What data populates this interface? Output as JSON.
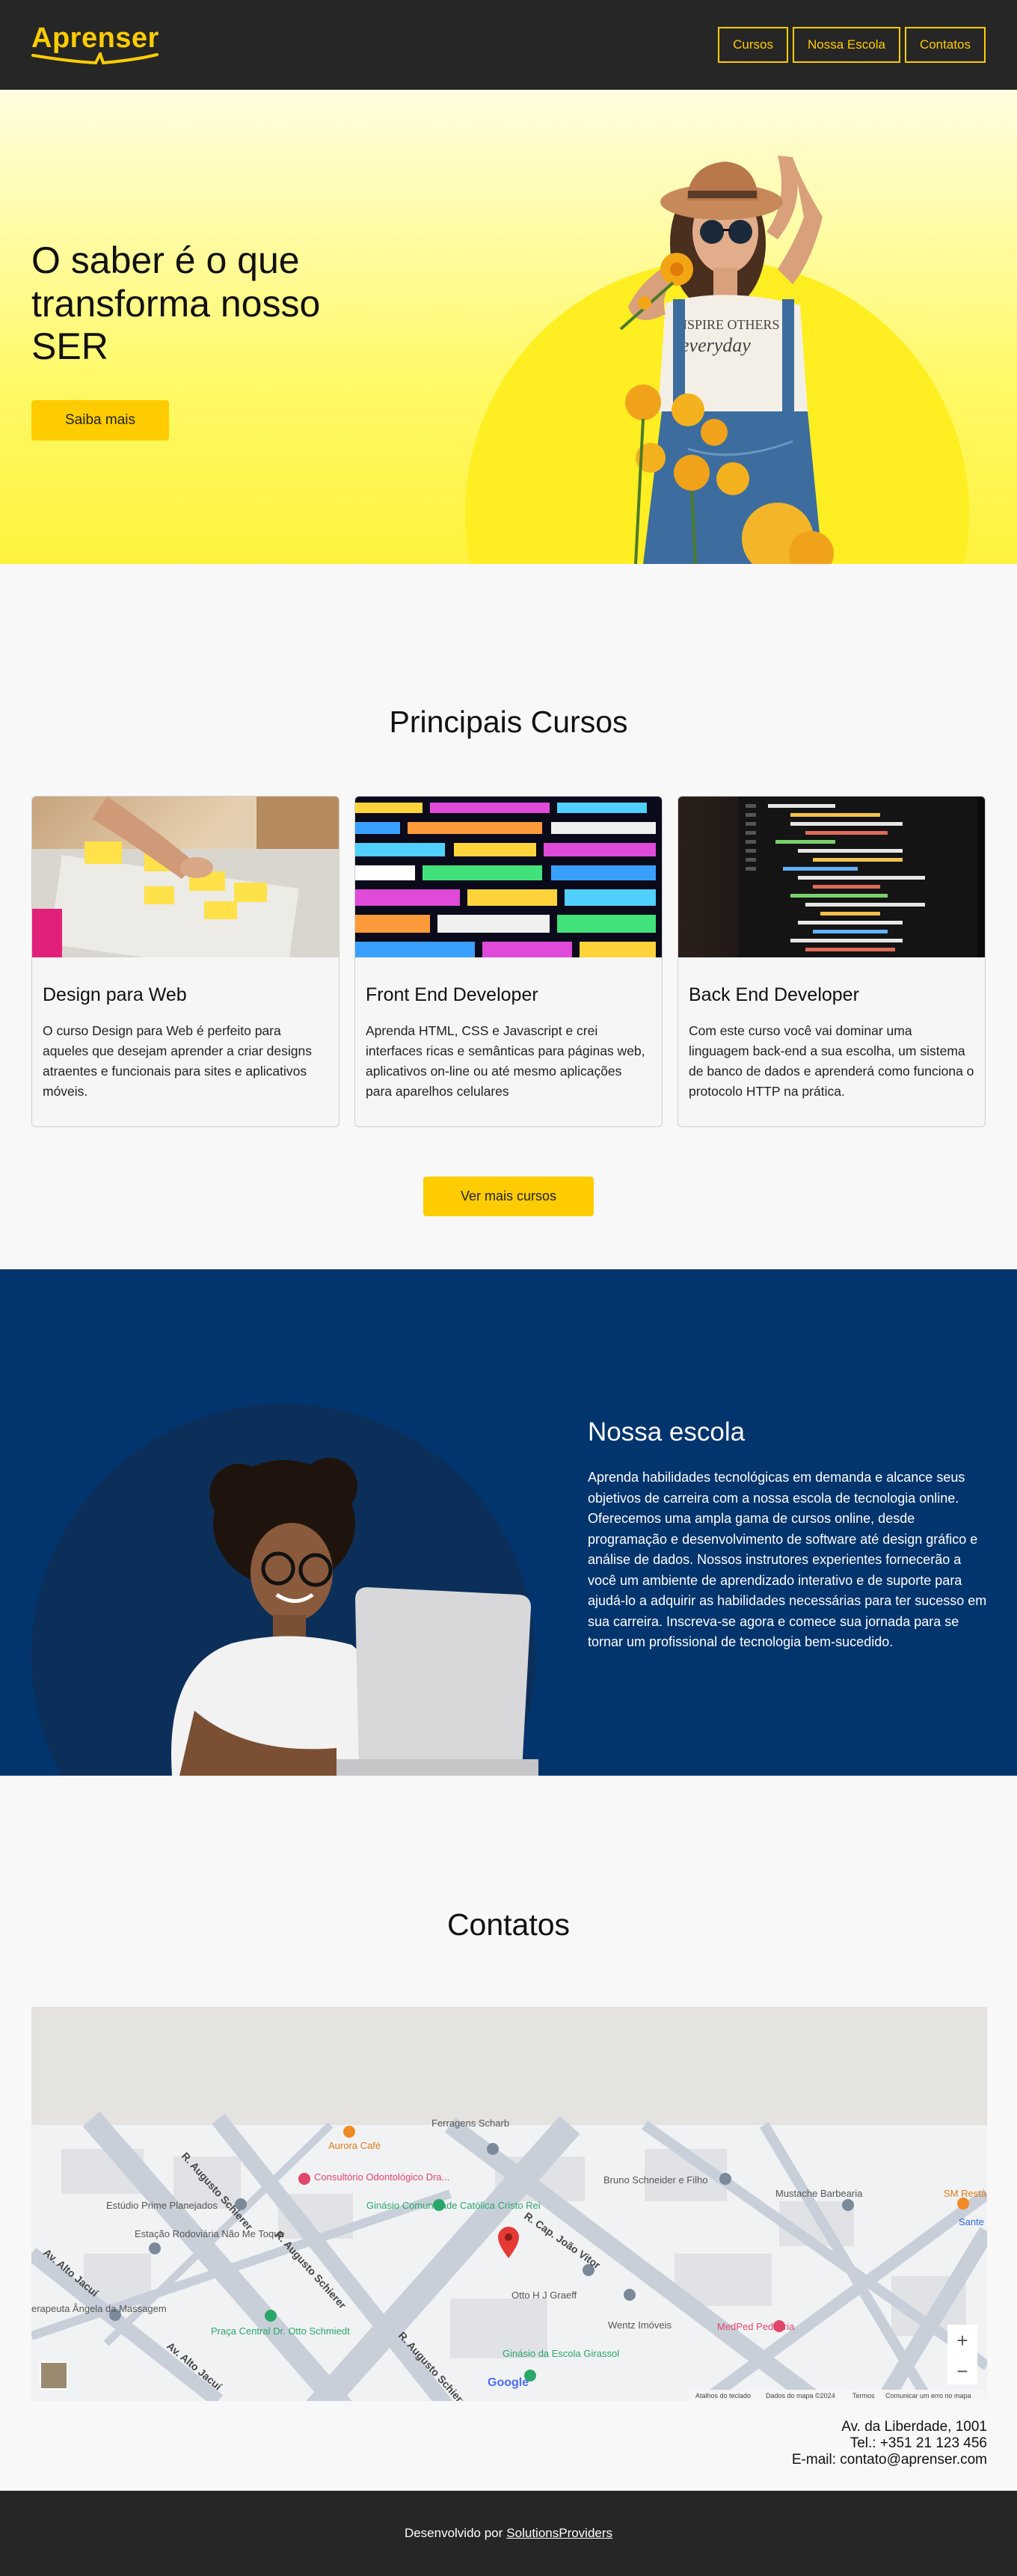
{
  "header": {
    "logo": "Aprenser",
    "nav": [
      {
        "label": "Cursos"
      },
      {
        "label": "Nossa Escola"
      },
      {
        "label": "Contatos"
      }
    ]
  },
  "hero": {
    "title": "O saber é o que transforma nosso SER",
    "button": "Saiba mais",
    "shirt_text_line1": "INSPIRE OTHERS",
    "shirt_text_line2": "everyday"
  },
  "courses": {
    "title": "Principais Cursos",
    "cards": [
      {
        "title": "Design para Web",
        "text": "O curso Design para Web é perfeito para aqueles que desejam aprender a criar designs atraentes e funcionais para sites e aplicativos móveis."
      },
      {
        "title": "Front End Developer",
        "text": "Aprenda HTML, CSS e Javascript e crei interfaces ricas e semânticas para páginas web, aplicativos on-line ou até mesmo aplicações para aparelhos celulares"
      },
      {
        "title": "Back End Developer",
        "text": "Com este curso você vai dominar uma linguagem back-end a sua escolha, um sistema de banco de dados e aprenderá como funciona o protocolo HTTP na prática."
      }
    ],
    "more_button": "Ver mais cursos"
  },
  "school": {
    "title": "Nossa escola",
    "text": "Aprenda habilidades tecnológicas em demanda e alcance seus objetivos de carreira com a nossa escola de tecnologia online. Oferecemos uma ampla gama de cursos online, desde programação e desenvolvimento de software até design gráfico e análise de dados. Nossos instrutores experientes fornecerão a você um ambiente de aprendizado interativo e de suporte para ajudá-lo a adquirir as habilidades necessárias para ter sucesso em sua carreira. Inscreva-se agora e comece sua jornada para se tornar um profissional de tecnologia bem-sucedido."
  },
  "contacts": {
    "title": "Contatos",
    "map": {
      "places": [
        "Ferragens Scharb",
        "Aurora Café",
        "Consultório Odontológico Dra...",
        "Ginásio Comunidade Católica Cristo Rei",
        "Bruno Schneider e Filho",
        "Mustache Barbearia",
        "Estúdio Prime Planejados",
        "Estação Rodoviária Não Me Toque",
        "Otto H J Graeff",
        "Wentz Imóveis",
        "MedPed Pediatria",
        "Praça Central Dr. Otto Schmiedt",
        "Ginásio da Escola Girassol",
        "erapeuta Ângela da Massagem",
        "SM Resta",
        "Sante"
      ],
      "streets": [
        "R. Augusto Schierer",
        "R. Augusto Schierer",
        "R. Augusto Schierer",
        "R. Cap. João Vitor",
        "Av. Alto Jacuí",
        "Av. Alto Jacuí"
      ],
      "footer": [
        "Atalhos do teclado",
        "Dados do mapa ©2024",
        "Termos",
        "Comunicar um erro no mapa"
      ],
      "zoom_in": "+",
      "zoom_out": "−",
      "google": "Google"
    },
    "address": [
      "Av. da Liberdade, 1001",
      "Tel.: +351 21 123 456",
      "E-mail: contato@aprenser.com"
    ]
  },
  "footer": {
    "prefix": "Desenvolvido por",
    "link": "SolutionsProviders"
  },
  "colors": {
    "accent": "#ffcc00",
    "dark": "#262626",
    "navy": "#02346d"
  }
}
